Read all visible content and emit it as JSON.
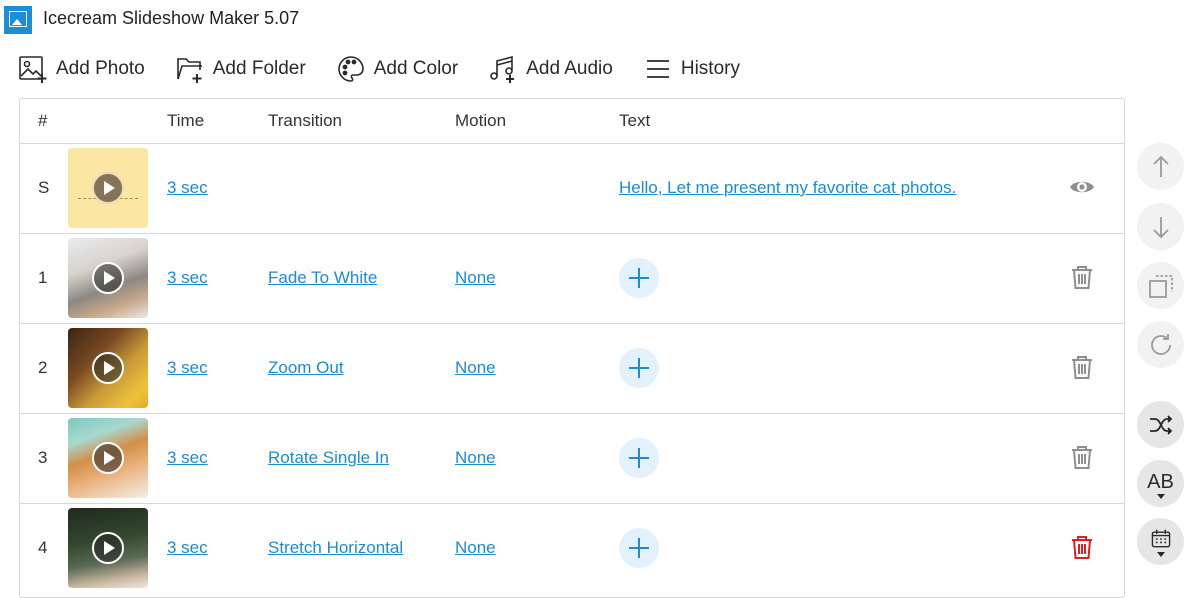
{
  "window": {
    "title": "Icecream Slideshow Maker 5.07",
    "icon": "picture-icon"
  },
  "toolbar": {
    "items": [
      {
        "label": "Add Photo",
        "icon": "add-photo-icon"
      },
      {
        "label": "Add Folder",
        "icon": "add-folder-icon"
      },
      {
        "label": "Add Color",
        "icon": "palette-icon"
      },
      {
        "label": "Add Audio",
        "icon": "add-audio-icon"
      },
      {
        "label": "History",
        "icon": "menu-lines-icon"
      }
    ]
  },
  "table": {
    "headers": {
      "num": "#",
      "time": "Time",
      "transition": "Transition",
      "motion": "Motion",
      "text": "Text"
    },
    "rows": [
      {
        "num": "S",
        "time": "3 sec",
        "transition": "",
        "motion": "",
        "text": "Hello, Let me present my favorite cat photos.",
        "action": "eye-icon",
        "thumb_color": "#fbe7a3"
      },
      {
        "num": "1",
        "time": "3 sec",
        "transition": "Fade To White",
        "motion": "None",
        "text": "",
        "action": "trash-icon",
        "thumb_color": "#9a8f86"
      },
      {
        "num": "2",
        "time": "3 sec",
        "transition": "Zoom Out",
        "motion": "None",
        "text": "",
        "action": "trash-icon",
        "thumb_color": "#8a5a22"
      },
      {
        "num": "3",
        "time": "3 sec",
        "transition": "Rotate Single In",
        "motion": "None",
        "text": "",
        "action": "trash-icon",
        "thumb_color": "#cf9a62"
      },
      {
        "num": "4",
        "time": "3 sec",
        "transition": "Stretch Horizontal",
        "motion": "None",
        "text": "",
        "action": "trash-icon-active",
        "thumb_color": "#2c3a2a"
      }
    ]
  },
  "colors": {
    "accent": "#1e8bd0",
    "trash_default": "#8f8f8f",
    "trash_active": "#e02020",
    "plus_bg": "#e2f1fb"
  },
  "side_buttons": [
    {
      "name": "move-up",
      "icon": "arrow-up-icon"
    },
    {
      "name": "move-down",
      "icon": "arrow-down-icon"
    },
    {
      "name": "crop",
      "icon": "crop-icon"
    },
    {
      "name": "rotate",
      "icon": "rotate-icon"
    },
    {
      "name": "shuffle",
      "icon": "shuffle-icon"
    },
    {
      "name": "text-style",
      "icon": "text-ab-icon",
      "label": "AB"
    },
    {
      "name": "date",
      "icon": "calendar-icon"
    }
  ]
}
